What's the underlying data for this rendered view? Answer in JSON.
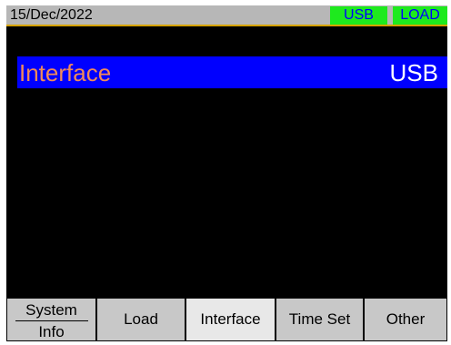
{
  "status_bar": {
    "date": "15/Dec/2022",
    "badges": [
      "USB",
      "LOAD"
    ]
  },
  "menu_row": {
    "label": "Interface",
    "value": "USB"
  },
  "softkeys": [
    {
      "line1": "System",
      "line2": "Info"
    },
    {
      "label": "Load"
    },
    {
      "label": "Interface"
    },
    {
      "label": "Time Set"
    },
    {
      "label": "Other"
    }
  ],
  "colors": {
    "status_bg": "#b7b7b7",
    "badge_bg": "#1eea1e",
    "badge_text": "#0000ff",
    "row_bg": "#0000ff",
    "row_label": "#f08a5a",
    "row_value": "#ffffff",
    "softkey_bg": "#c8c8c8"
  }
}
